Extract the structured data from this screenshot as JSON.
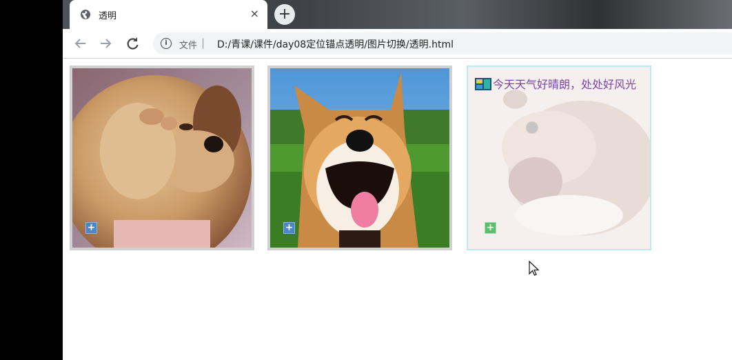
{
  "browser": {
    "tab_title": "透明",
    "tab_close": "×",
    "new_tab": "+",
    "address": {
      "scheme_label": "文件",
      "separator": "|",
      "url": "D:/青课/课件/day08定位锚点透明/图片切换/透明.html"
    }
  },
  "page": {
    "cards": [
      {
        "subject": "puppy covering its eyes",
        "badge": "+"
      },
      {
        "subject": "smiling shiba inu",
        "badge": "+"
      },
      {
        "subject": "hamster eating",
        "badge": "+",
        "caption": "今天天气好晴朗，处处好风光"
      }
    ]
  },
  "colors": {
    "caption_text": "#7a45a3",
    "card_border": "#d0d0d0",
    "active_card_border": "#b8ecef"
  }
}
